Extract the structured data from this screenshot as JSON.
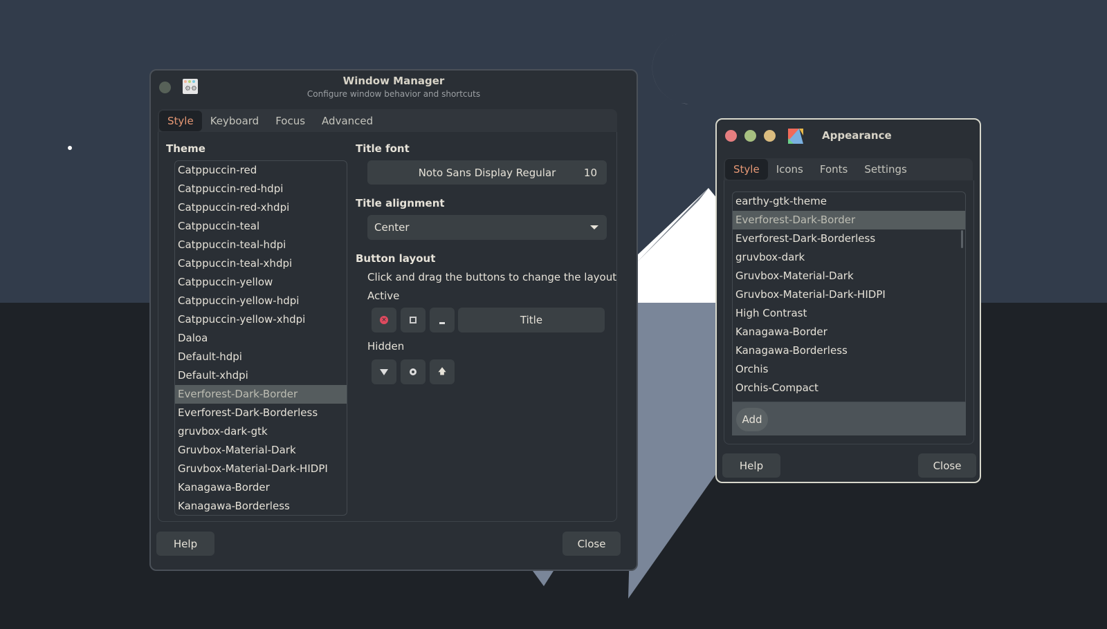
{
  "window_manager": {
    "title": "Window Manager",
    "subtitle": "Configure window behavior and shortcuts",
    "icon": "window-settings-icon",
    "tabs": [
      "Style",
      "Keyboard",
      "Focus",
      "Advanced"
    ],
    "active_tab": "Style",
    "theme_label": "Theme",
    "themes": [
      "Catppuccin-red",
      "Catppuccin-red-hdpi",
      "Catppuccin-red-xhdpi",
      "Catppuccin-teal",
      "Catppuccin-teal-hdpi",
      "Catppuccin-teal-xhdpi",
      "Catppuccin-yellow",
      "Catppuccin-yellow-hdpi",
      "Catppuccin-yellow-xhdpi",
      "Daloa",
      "Default-hdpi",
      "Default-xhdpi",
      "Everforest-Dark-Border",
      "Everforest-Dark-Borderless",
      "gruvbox-dark-gtk",
      "Gruvbox-Material-Dark",
      "Gruvbox-Material-Dark-HIDPI",
      "Kanagawa-Border",
      "Kanagawa-Borderless"
    ],
    "selected_theme": "Everforest-Dark-Border",
    "title_font_label": "Title font",
    "title_font": "Noto Sans Display Regular",
    "title_font_size": "10",
    "title_alignment_label": "Title alignment",
    "title_alignment": "Center",
    "button_layout_label": "Button layout",
    "button_layout_hint": "Click and drag the buttons to change the layout",
    "active_label": "Active",
    "title_button": "Title",
    "hidden_label": "Hidden",
    "help": "Help",
    "close": "Close"
  },
  "appearance": {
    "title": "Appearance",
    "tabs": [
      "Style",
      "Icons",
      "Fonts",
      "Settings"
    ],
    "active_tab": "Style",
    "themes": [
      "earthy-gtk-theme",
      "Everforest-Dark-Border",
      "Everforest-Dark-Borderless",
      "gruvbox-dark",
      "Gruvbox-Material-Dark",
      "Gruvbox-Material-Dark-HIDPI",
      "High Contrast",
      "Kanagawa-Border",
      "Kanagawa-Borderless",
      "Orchis",
      "Orchis-Compact"
    ],
    "selected_theme": "Everforest-Dark-Border",
    "add": "Add",
    "help": "Help",
    "close": "Close"
  },
  "colors": {
    "accent": "#e69875",
    "close": "#e67e80",
    "min": "#a7c080",
    "max": "#dbbc7f",
    "sky": "#323c4b",
    "ground": "#1e2227"
  }
}
